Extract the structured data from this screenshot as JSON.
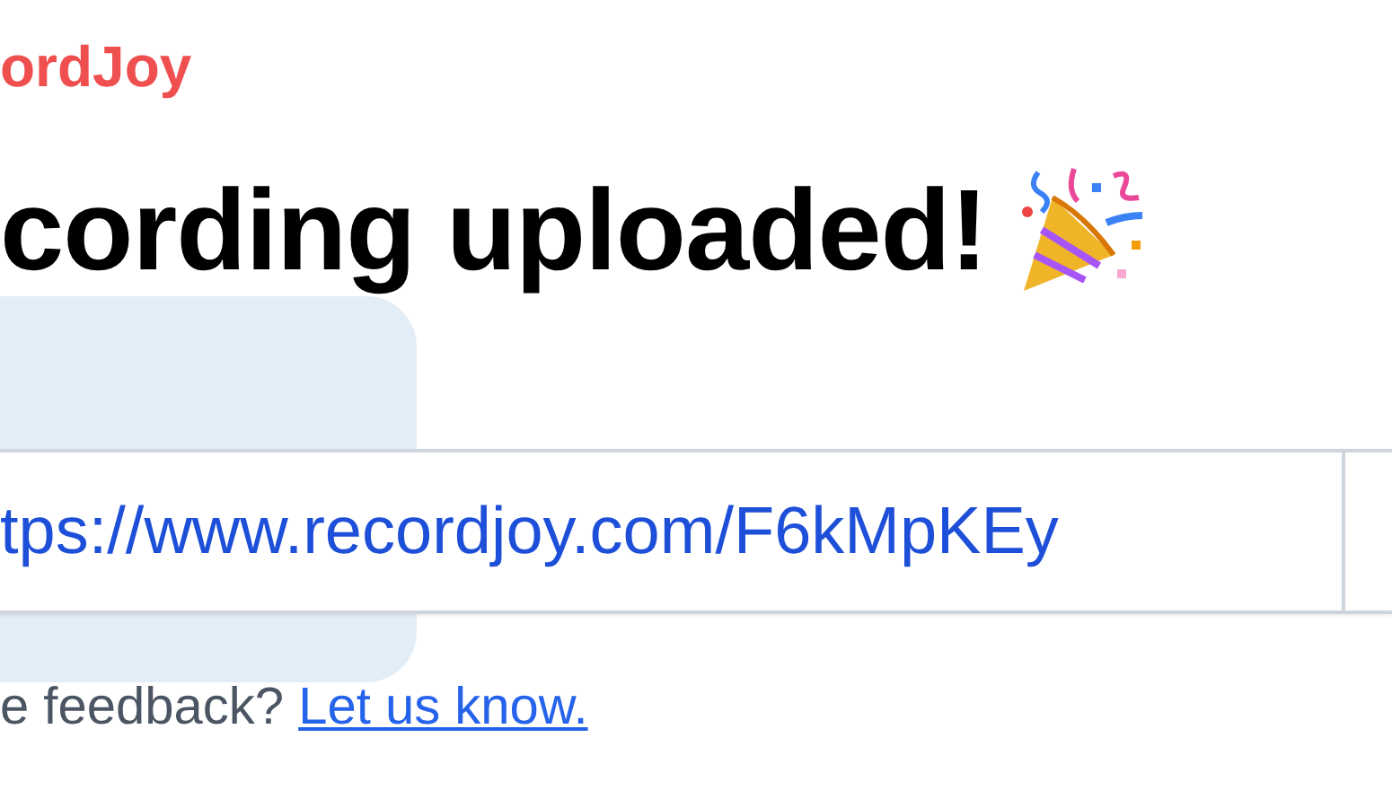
{
  "brand": "ordJoy",
  "heading": "cording uploaded!",
  "share_link": {
    "value": "tps://www.recordjoy.com/F6kMpKEy"
  },
  "feedback": {
    "text": "e feedback?",
    "link": "Let us know."
  }
}
